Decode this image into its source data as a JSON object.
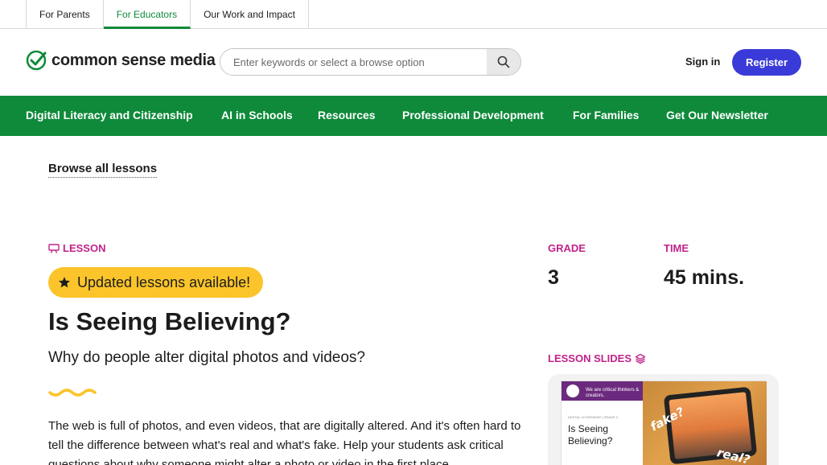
{
  "top_tabs": [
    {
      "label": "For Parents",
      "active": false
    },
    {
      "label": "For Educators",
      "active": true
    },
    {
      "label": "Our Work and Impact",
      "active": false
    }
  ],
  "header": {
    "logo_text": "common sense media",
    "search_placeholder": "Enter keywords or select a browse option",
    "sign_in": "Sign in",
    "register": "Register"
  },
  "nav": {
    "items": [
      {
        "label": "Digital Literacy and Citizenship"
      },
      {
        "label": "AI in Schools"
      },
      {
        "label": "Resources"
      },
      {
        "label": "Professional Development"
      },
      {
        "label": "For Families"
      },
      {
        "label": "Get Our Newsletter"
      }
    ]
  },
  "content": {
    "browse_link": "Browse all lessons",
    "lesson_tag": "LESSON",
    "updated_badge": "Updated lessons available!",
    "title": "Is Seeing Believing?",
    "subtitle": "Why do people alter digital photos and videos?",
    "description": "The web is full of photos, and even videos, that are digitally altered. And it's often hard to tell the difference between what's real and what's fake. Help your students ask critical questions about why someone might alter a photo or video in the first place."
  },
  "meta": {
    "grade_label": "GRADE",
    "grade_value": "3",
    "time_label": "TIME",
    "time_value": "45 mins."
  },
  "slides": {
    "label": "LESSON SLIDES",
    "thumb_band_text": "We are critical thinkers & creators.",
    "thumb_small": "DIGITAL CITIZENSHIP | GRADE 3",
    "thumb_title": "Is Seeing Believing?",
    "scribble_fake": "fake?",
    "scribble_real": "real?"
  },
  "colors": {
    "brand_green": "#0e8a3a",
    "accent_magenta": "#c0238a",
    "badge_yellow": "#fbc42a",
    "register_blue": "#3a3ad9"
  }
}
